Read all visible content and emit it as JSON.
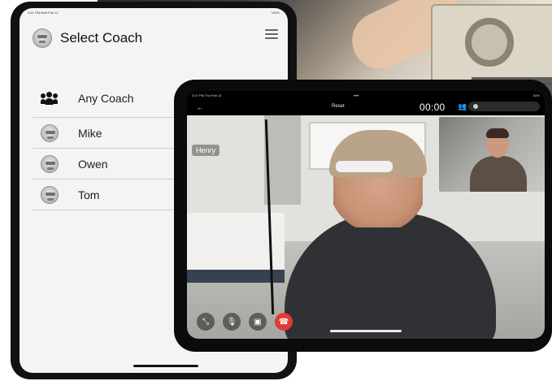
{
  "left_app": {
    "status_time": "9:41 PM Wed Feb 12",
    "status_right": "100%",
    "title": "Select Coach",
    "coaches": [
      {
        "label": "Any Coach",
        "icon": "group-icon"
      },
      {
        "label": "Mike",
        "icon": "avatar-icon"
      },
      {
        "label": "Owen",
        "icon": "avatar-icon"
      },
      {
        "label": "Tom",
        "icon": "avatar-icon"
      }
    ]
  },
  "right_app": {
    "status_time": "3:07 PM Thu Feb 13",
    "status_right": "84%",
    "session_label": "Reset",
    "timer": "00:00",
    "participant_name": "Henry",
    "icons": [
      "back-icon",
      "record-icon",
      "share-icon",
      "menu-icon",
      "minimize-icon",
      "mic-icon",
      "camera-icon",
      "end-call-icon"
    ]
  },
  "colors": {
    "end_call": "#e23b35",
    "list_bg": "#f4f4f5",
    "divider": "#cfcfd4"
  }
}
